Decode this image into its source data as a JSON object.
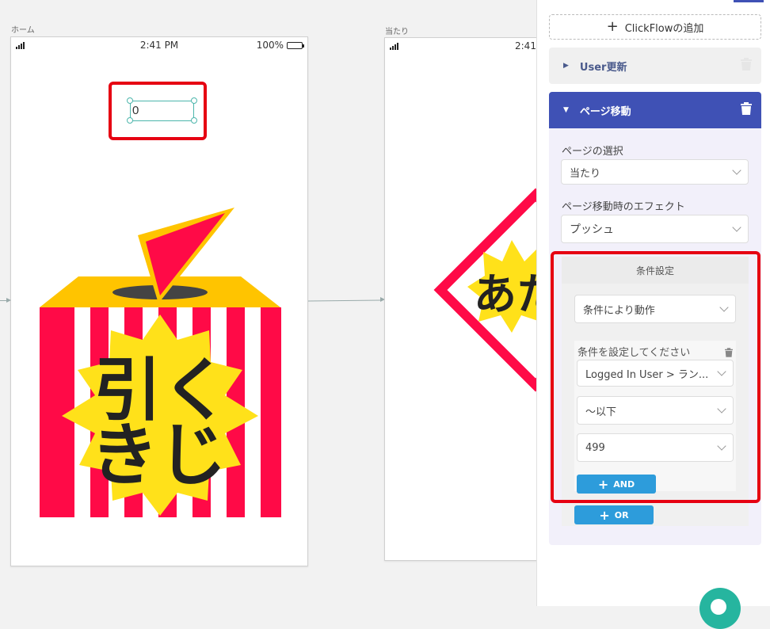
{
  "screens": {
    "home": {
      "label": "ホーム",
      "time": "2:41 PM",
      "battery": "100%",
      "counter_value": "0",
      "kuji_text_line1": "引く",
      "kuji_text_line2": "きじ"
    },
    "win": {
      "label": "当たり",
      "time": "2:41",
      "win_text": "あた"
    }
  },
  "panel": {
    "add_clickflow_label": "ClickFlowの追加",
    "user_update_label": "User更新",
    "page_move_label": "ページ移動",
    "page_select_label": "ページの選択",
    "page_select_value": "当たり",
    "effect_label": "ページ移動時のエフェクト",
    "effect_value": "プッシュ",
    "condition_title": "条件設定",
    "condition_mode_value": "条件により動作",
    "condition_hint": "条件を設定してください",
    "condition_field_value": "Logged In User > ラン...",
    "condition_operator_value": "〜以下",
    "condition_value": "499",
    "and_button_label": "AND",
    "or_button_label": "OR"
  },
  "colors": {
    "accent": "#3f51b5",
    "highlight": "#e60012",
    "button_blue": "#2d9cdb",
    "fab": "#26b59f",
    "kuji_red": "#ff0a47",
    "kuji_yellow": "#ffd600",
    "kuji_orange": "#ffc400"
  }
}
